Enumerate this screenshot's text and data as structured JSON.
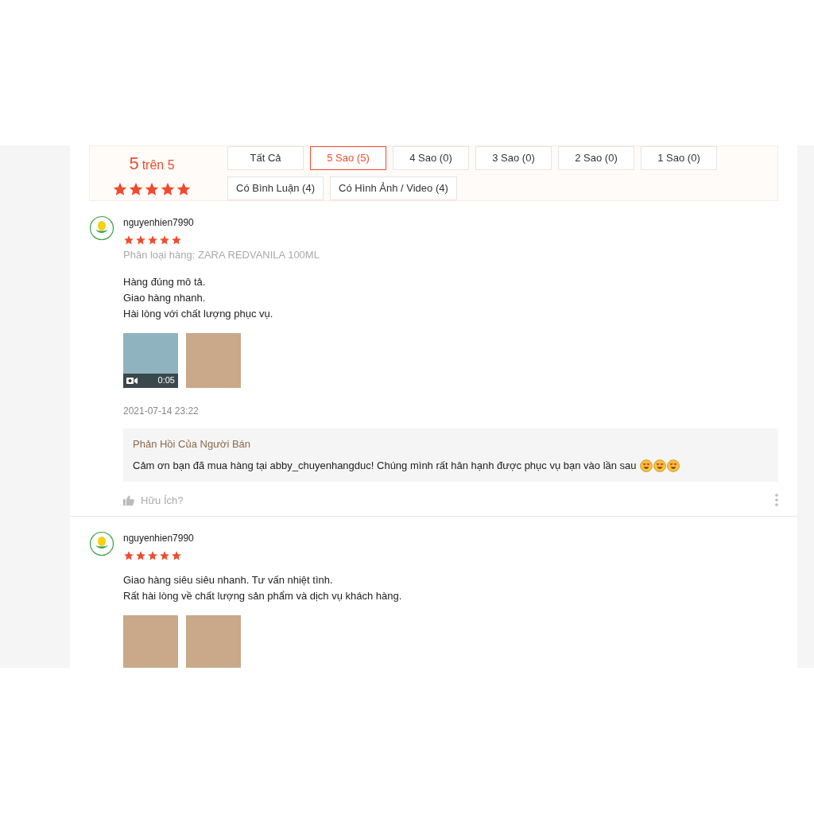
{
  "rating_summary": {
    "score": "5",
    "suffix": "trên 5",
    "stars": 5
  },
  "filters": [
    {
      "label": "Tất Cả",
      "selected": false
    },
    {
      "label": "5 Sao (5)",
      "selected": true
    },
    {
      "label": "4 Sao (0)",
      "selected": false
    },
    {
      "label": "3 Sao (0)",
      "selected": false
    },
    {
      "label": "2 Sao (0)",
      "selected": false
    },
    {
      "label": "1 Sao (0)",
      "selected": false
    },
    {
      "label": "Có Bình Luận (4)",
      "selected": false
    },
    {
      "label": "Có Hình Ảnh / Video (4)",
      "selected": false
    }
  ],
  "reviews": [
    {
      "username": "nguyenhien7990",
      "stars": 5,
      "variation": "Phân loại hàng: ZARA REDVANILA 100ML",
      "lines": [
        "Hàng đúng mô tả.",
        "Giao hàng nhanh.",
        "Hài lòng với chất lượng phục vụ."
      ],
      "media": [
        {
          "kind": "video",
          "duration": "0:05"
        },
        {
          "kind": "photo"
        }
      ],
      "date": "2021-07-14 23:22",
      "seller_reply": {
        "title": "Phản Hồi Của Người Bán",
        "text": "Cảm ơn bạn đã mua hàng tại abby_chuyenhangduc! Chúng mình rất hân hạnh được phục vụ bạn vào lần sau",
        "emojis": [
          {
            "kind": "heart_eyes"
          },
          {
            "kind": "heart_eyes"
          },
          {
            "kind": "heart_eyes"
          }
        ]
      },
      "helpful": "Hữu Ích?"
    },
    {
      "username": "nguyenhien7990",
      "stars": 5,
      "lines": [
        "Giao hàng siêu siêu nhanh. Tư vấn nhiệt tình.",
        "Rất hài lòng về chất lượng sản phẩm và dịch vụ khách hàng."
      ],
      "media": [
        {
          "kind": "photo"
        },
        {
          "kind": "photo"
        }
      ]
    }
  ]
}
